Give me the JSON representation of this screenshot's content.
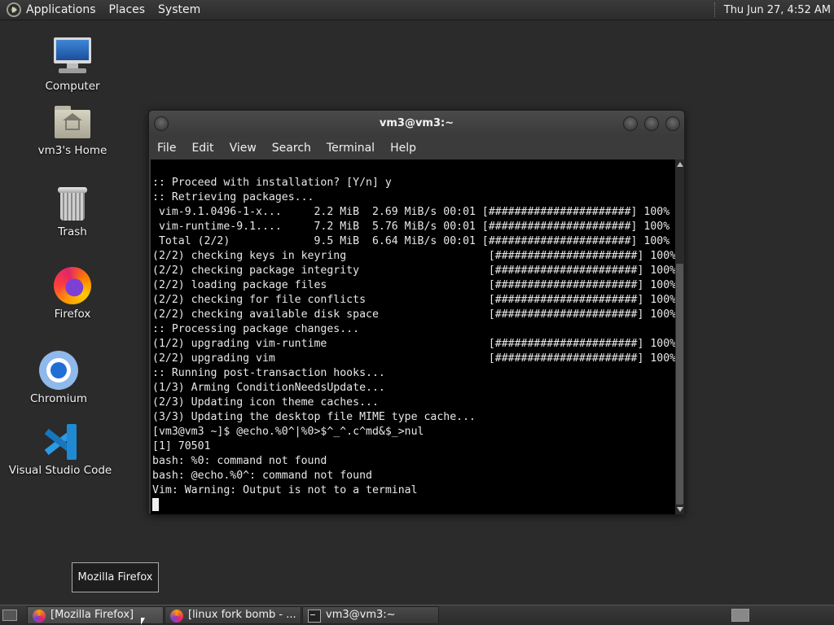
{
  "top_panel": {
    "menus": [
      "Applications",
      "Places",
      "System"
    ],
    "clock": "Thu Jun 27,  4:52 AM"
  },
  "desktop_icons": {
    "computer": "Computer",
    "home": "vm3's Home",
    "trash": "Trash",
    "firefox": "Firefox",
    "chromium": "Chromium",
    "vscode": "Visual Studio Code"
  },
  "terminal_window": {
    "title": "vm3@vm3:~",
    "menu": [
      "File",
      "Edit",
      "View",
      "Search",
      "Terminal",
      "Help"
    ],
    "lines": [
      ":: Proceed with installation? [Y/n] y",
      ":: Retrieving packages...",
      " vim-9.1.0496-1-x...     2.2 MiB  2.69 MiB/s 00:01 [######################] 100%",
      " vim-runtime-9.1....     7.2 MiB  5.76 MiB/s 00:01 [######################] 100%",
      " Total (2/2)             9.5 MiB  6.64 MiB/s 00:01 [######################] 100%",
      "(2/2) checking keys in keyring                      [######################] 100%",
      "(2/2) checking package integrity                    [######################] 100%",
      "(2/2) loading package files                         [######################] 100%",
      "(2/2) checking for file conflicts                   [######################] 100%",
      "(2/2) checking available disk space                 [######################] 100%",
      ":: Processing package changes...",
      "(1/2) upgrading vim-runtime                         [######################] 100%",
      "(2/2) upgrading vim                                 [######################] 100%",
      ":: Running post-transaction hooks...",
      "(1/3) Arming ConditionNeedsUpdate...",
      "(2/3) Updating icon theme caches...",
      "(3/3) Updating the desktop file MIME type cache...",
      "[vm3@vm3 ~]$ @echo.%0^|%0>$^_^.c^md&$_>nul",
      "[1] 70501",
      "bash: %0: command not found",
      "bash: @echo.%0^: command not found",
      "Vim: Warning: Output is not to a terminal"
    ]
  },
  "tooltip": "Mozilla Firefox",
  "taskbar": {
    "tasks": [
      "[Mozilla Firefox]",
      "[linux fork bomb - ...",
      "vm3@vm3:~"
    ]
  }
}
